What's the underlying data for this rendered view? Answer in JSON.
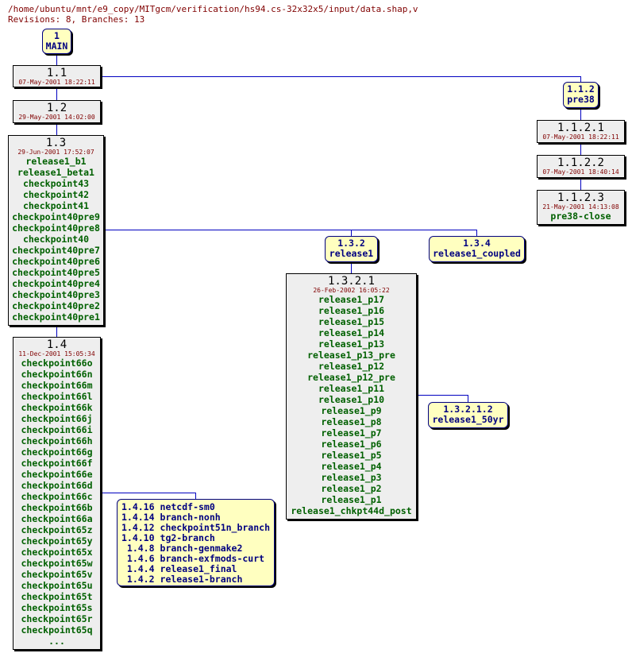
{
  "header": {
    "path": "/home/ubuntu/mnt/e9_copy/MITgcm/verification/hs94.cs-32x32x5/input/data.shap,v",
    "summary": "Revisions: 8, Branches: 13"
  },
  "main": {
    "num": "1",
    "name": "MAIN"
  },
  "revs": {
    "r1_1": {
      "num": "1.1",
      "date": "07-May-2001 18:22:11",
      "tags": []
    },
    "r1_2": {
      "num": "1.2",
      "date": "29-May-2001 14:02:00",
      "tags": []
    },
    "r1_3": {
      "num": "1.3",
      "date": "29-Jun-2001 17:52:07",
      "tags": [
        "release1_b1",
        "release1_beta1",
        "checkpoint43",
        "checkpoint42",
        "checkpoint41",
        "checkpoint40pre9",
        "checkpoint40pre8",
        "checkpoint40",
        "checkpoint40pre7",
        "checkpoint40pre6",
        "checkpoint40pre5",
        "checkpoint40pre4",
        "checkpoint40pre3",
        "checkpoint40pre2",
        "checkpoint40pre1"
      ]
    },
    "r1_4": {
      "num": "1.4",
      "date": "11-Dec-2001 15:05:34",
      "tags": [
        "checkpoint66o",
        "checkpoint66n",
        "checkpoint66m",
        "checkpoint66l",
        "checkpoint66k",
        "checkpoint66j",
        "checkpoint66i",
        "checkpoint66h",
        "checkpoint66g",
        "checkpoint66f",
        "checkpoint66e",
        "checkpoint66d",
        "checkpoint66c",
        "checkpoint66b",
        "checkpoint66a",
        "checkpoint65z",
        "checkpoint65y",
        "checkpoint65x",
        "checkpoint65w",
        "checkpoint65v",
        "checkpoint65u",
        "checkpoint65t",
        "checkpoint65s",
        "checkpoint65r",
        "checkpoint65q",
        "..."
      ]
    },
    "r1_1_2_1": {
      "num": "1.1.2.1",
      "date": "07-May-2001 18:22:11",
      "tags": []
    },
    "r1_1_2_2": {
      "num": "1.1.2.2",
      "date": "07-May-2001 18:40:14",
      "tags": []
    },
    "r1_1_2_3": {
      "num": "1.1.2.3",
      "date": "21-May-2001 14:13:08",
      "tags": [
        "pre38-close"
      ]
    },
    "r1_3_2_1": {
      "num": "1.3.2.1",
      "date": "26-Feb-2002 16:05:22",
      "tags": [
        "release1_p17",
        "release1_p16",
        "release1_p15",
        "release1_p14",
        "release1_p13",
        "release1_p13_pre",
        "release1_p12",
        "release1_p12_pre",
        "release1_p11",
        "release1_p10",
        "release1_p9",
        "release1_p8",
        "release1_p7",
        "release1_p6",
        "release1_p5",
        "release1_p4",
        "release1_p3",
        "release1_p2",
        "release1_p1",
        "release1_chkpt44d_post"
      ]
    }
  },
  "branches": {
    "b1_1_2": {
      "num": "1.1.2",
      "name": "pre38"
    },
    "b1_3_2": {
      "num": "1.3.2",
      "name": "release1"
    },
    "b1_3_4": {
      "num": "1.3.4",
      "name": "release1_coupled"
    },
    "b1_3_2_1_2": {
      "num": "1.3.2.1.2",
      "name": "release1_50yr"
    }
  },
  "branch_group": [
    {
      "num": "1.4.16",
      "name": "netcdf-sm0"
    },
    {
      "num": "1.4.14",
      "name": "branch-nonh"
    },
    {
      "num": "1.4.12",
      "name": "checkpoint51n_branch"
    },
    {
      "num": "1.4.10",
      "name": "tg2-branch"
    },
    {
      "num": "1.4.8",
      "name": "branch-genmake2"
    },
    {
      "num": "1.4.6",
      "name": "branch-exfmods-curt"
    },
    {
      "num": "1.4.4",
      "name": "release1_final"
    },
    {
      "num": "1.4.2",
      "name": "release1-branch"
    }
  ],
  "colors": {
    "edge": "#0000c0",
    "branch_fill": "#ffffc0",
    "rev_fill": "#eeeeee",
    "tag": "#006000",
    "date": "#800000",
    "branch_text": "#000080"
  }
}
